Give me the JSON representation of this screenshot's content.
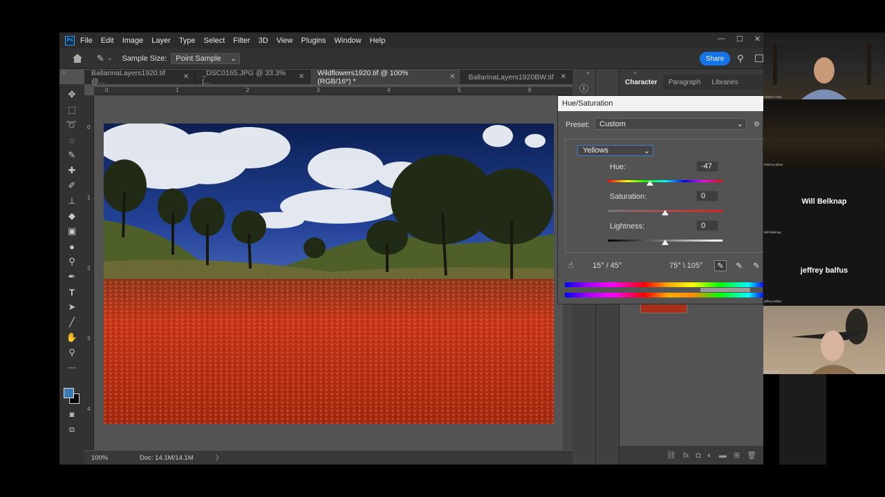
{
  "app": {
    "logo": "Ps",
    "menu": [
      "File",
      "Edit",
      "Image",
      "Layer",
      "Type",
      "Select",
      "Filter",
      "3D",
      "View",
      "Plugins",
      "Window",
      "Help"
    ],
    "window_controls": [
      "—",
      "☐",
      "✕"
    ]
  },
  "options_bar": {
    "sample_size_label": "Sample Size:",
    "sample_size_value": "Point Sample",
    "share_label": "Share"
  },
  "tabs": [
    {
      "label": "BallarinaLayers1920.tif @...",
      "active": false
    },
    {
      "label": "_DSC0165.JPG @ 33.3% (...",
      "active": false
    },
    {
      "label": "Wildflowers1920.tif @ 100% (RGB/16*) *",
      "active": true
    },
    {
      "label": "BallarinaLayers1920BW.tif",
      "active": false
    }
  ],
  "ruler": {
    "h_ticks": [
      "0",
      "1",
      "2",
      "3",
      "4",
      "5",
      "6"
    ],
    "v_ticks": [
      "0",
      "1",
      "2",
      "3",
      "4"
    ]
  },
  "status": {
    "zoom": "100%",
    "doc": "Doc: 14.1M/14.1M",
    "arrow": "〉"
  },
  "panel_tabs": [
    "Character",
    "Paragraph",
    "Libraries"
  ],
  "hue_saturation": {
    "title": "Hue/Saturation",
    "preset_label": "Preset:",
    "preset_value": "Custom",
    "channel": "Yellows",
    "hue_label": "Hue:",
    "hue_value": "-47",
    "hue_slider": -47,
    "saturation_label": "Saturation:",
    "saturation_value": "0",
    "lightness_label": "Lightness:",
    "lightness_value": "0",
    "range_left": "15° / 45°",
    "range_right": "75° \\ 105°"
  },
  "participants": [
    {
      "name": "",
      "small": "LBSCC Host"
    },
    {
      "name": "",
      "small": "Patricia Silver"
    },
    {
      "name": "Will Belknap",
      "small": "Will Belknap"
    },
    {
      "name": "jeffrey balfus",
      "small": "jeffrey balfus"
    },
    {
      "name": "",
      "small": "Rick Tavan"
    }
  ],
  "colors": {
    "accent": "#1473e6",
    "foreground": "#3a7ab8",
    "background": "#000000",
    "flowers": "#c7381b"
  }
}
